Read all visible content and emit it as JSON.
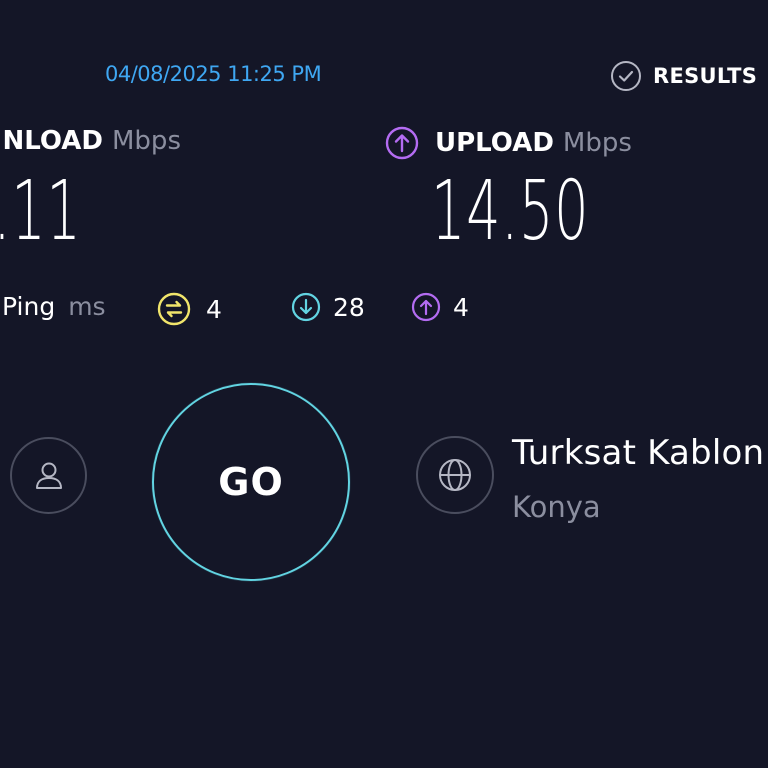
{
  "header": {
    "timestamp": "04/08/2025 11:25 PM",
    "results_label": "RESULTS"
  },
  "download": {
    "title": "NLOAD",
    "unit": "Mbps",
    "value": ".11"
  },
  "upload": {
    "title": "UPLOAD",
    "unit": "Mbps",
    "value": "14.50"
  },
  "ping": {
    "label": "Ping",
    "unit": "ms",
    "idle": "4",
    "download": "28",
    "upload": "4"
  },
  "go_button": {
    "label": "GO"
  },
  "server": {
    "provider": "Turksat Kablon",
    "location": "Konya"
  },
  "icons": {
    "results": "check-circle-icon",
    "upload": "upload-arrow-icon",
    "ping_idle": "ping-idle-icon",
    "ping_download": "download-arrow-icon",
    "ping_upload": "upload-arrow-icon",
    "user": "user-icon",
    "server": "globe-icon"
  },
  "colors": {
    "background": "#141627",
    "timestamp": "#3fa7f2",
    "upload_accent": "#b46cf2",
    "ping_idle": "#f1e56b",
    "ping_download": "#62d4e2",
    "ping_upload": "#b46cf2",
    "go_ring": "#62d4e2",
    "muted_text": "#8b8e9f"
  }
}
